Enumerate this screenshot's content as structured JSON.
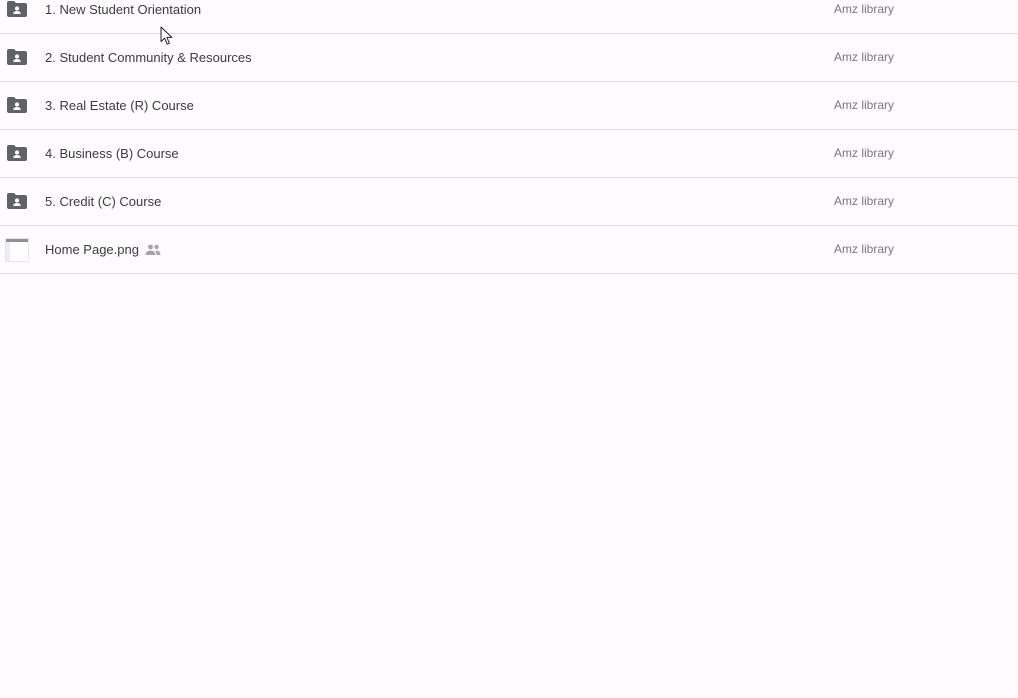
{
  "files": [
    {
      "name": "1. New Student Orientation",
      "owner": "Amz library",
      "type": "shared-folder",
      "icon": "shared-folder-icon"
    },
    {
      "name": "2. Student Community & Resources",
      "owner": "Amz library",
      "type": "shared-folder",
      "icon": "shared-folder-icon"
    },
    {
      "name": "3. Real Estate (R) Course",
      "owner": "Amz library",
      "type": "shared-folder",
      "icon": "shared-folder-icon"
    },
    {
      "name": "4. Business (B) Course",
      "owner": "Amz library",
      "type": "shared-folder",
      "icon": "shared-folder-icon"
    },
    {
      "name": "5. Credit (C) Course",
      "owner": "Amz library",
      "type": "shared-folder",
      "icon": "shared-folder-icon"
    },
    {
      "name": "Home Page.png",
      "owner": "Amz library",
      "type": "image",
      "icon": "image-thumbnail-icon",
      "shared": true,
      "shared_icon": "people-icon"
    }
  ],
  "colors": {
    "background": "#fdfbfe",
    "folder_icon": "#5f6368",
    "divider": "#dedde0",
    "name_text": "#3c3c3c",
    "owner_text": "#7a7a7a"
  }
}
